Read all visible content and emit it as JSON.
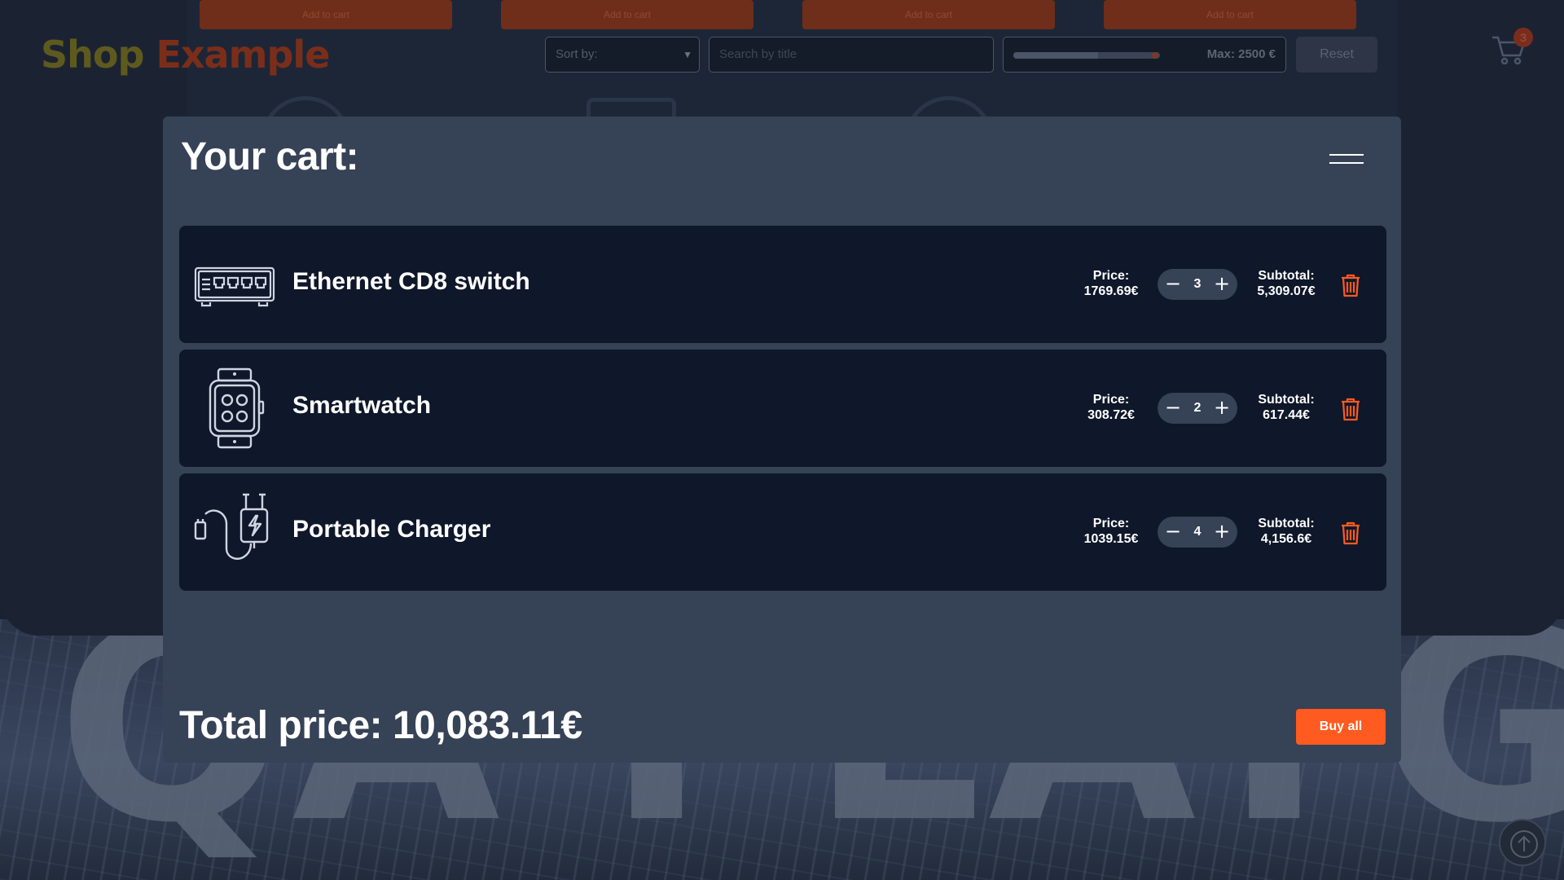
{
  "header": {
    "logo_part1": "Shop",
    "logo_part2": "Example",
    "sort_label": "Sort by:",
    "search_placeholder": "Search by title",
    "price_range": {
      "value_fraction": 0.58,
      "max_label": "Max: 2500 €"
    },
    "reset_label": "Reset",
    "cart_count": "3"
  },
  "background": {
    "watermark": "QA PLAYGROUND",
    "card_button_label": "Add to cart"
  },
  "cart": {
    "title": "Your cart:",
    "items": [
      {
        "name": "Ethernet CD8 switch",
        "icon": "ethernet-switch-icon",
        "price_label": "Price:",
        "price": "1769.69€",
        "qty": "3",
        "subtotal_label": "Subtotal:",
        "subtotal": "5,309.07€"
      },
      {
        "name": "Smartwatch",
        "icon": "smartwatch-icon",
        "price_label": "Price:",
        "price": "308.72€",
        "qty": "2",
        "subtotal_label": "Subtotal:",
        "subtotal": "617.44€"
      },
      {
        "name": "Portable Charger",
        "icon": "charger-icon",
        "price_label": "Price:",
        "price": "1039.15€",
        "qty": "4",
        "subtotal_label": "Subtotal:",
        "subtotal": "4,156.6€"
      }
    ],
    "total_text": "Total price: 10,083.11€",
    "buy_label": "Buy all"
  },
  "colors": {
    "accent": "#ff5a1f",
    "trash": "#ff5a1f",
    "modal_bg": "#364256",
    "row_bg": "#0f172a"
  }
}
